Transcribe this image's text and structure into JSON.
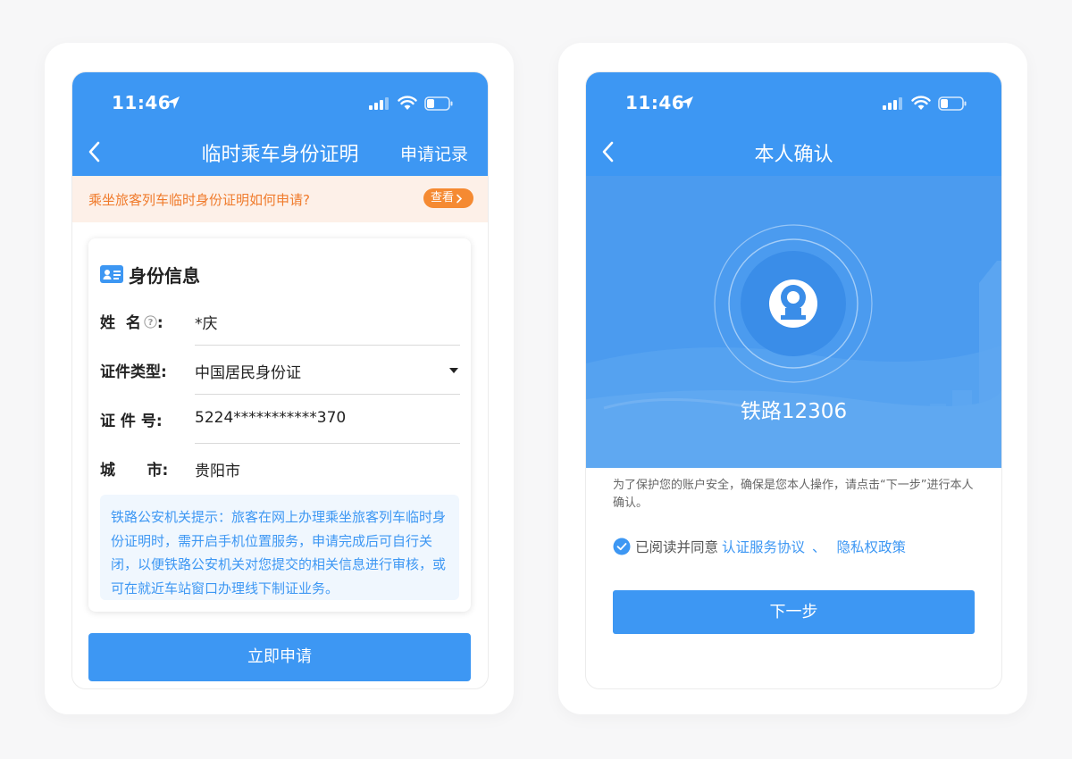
{
  "status_bar": {
    "time": "11:46"
  },
  "apply_screen": {
    "nav": {
      "title": "临时乘车身份证明",
      "right_action": "申请记录"
    },
    "notice": {
      "text": "乘坐旅客列车临时身份证明如何申请?",
      "button": "查看"
    },
    "section_title": "身份信息",
    "fields": [
      {
        "label": "姓  名",
        "label_suffix": ":",
        "value": "*庆"
      },
      {
        "label": "证件类型:",
        "value": "中国居民身份证"
      },
      {
        "label": "证 件 号:",
        "value": "5224***********370"
      },
      {
        "label": "城      市:",
        "value": "贵阳市"
      }
    ],
    "tip": "铁路公安机关提示：旅客在网上办理乘坐旅客列车临时身份证明时，需开启手机位置服务，申请完成后可自行关闭，以便铁路公安机关对您提交的相关信息进行审核，或可在就近车站窗口办理线下制证业务。",
    "submit_button": "立即申请"
  },
  "confirm_screen": {
    "nav": {
      "title": "本人确认"
    },
    "app_name": "铁路12306",
    "description": "为了保护您的账户安全，确保是您本人操作，请点击“下一步”进行本人确认。",
    "agreement": {
      "prefix": "已阅读并同意",
      "link1": "认证服务协议",
      "separator": "、",
      "link2": "隐私权政策"
    },
    "next_button": "下一步"
  },
  "colors": {
    "primary": "#3d97f3",
    "notice_bg": "#fdf0e8",
    "notice_text": "#f07b2c",
    "tip_bg": "#f0f7fe"
  }
}
